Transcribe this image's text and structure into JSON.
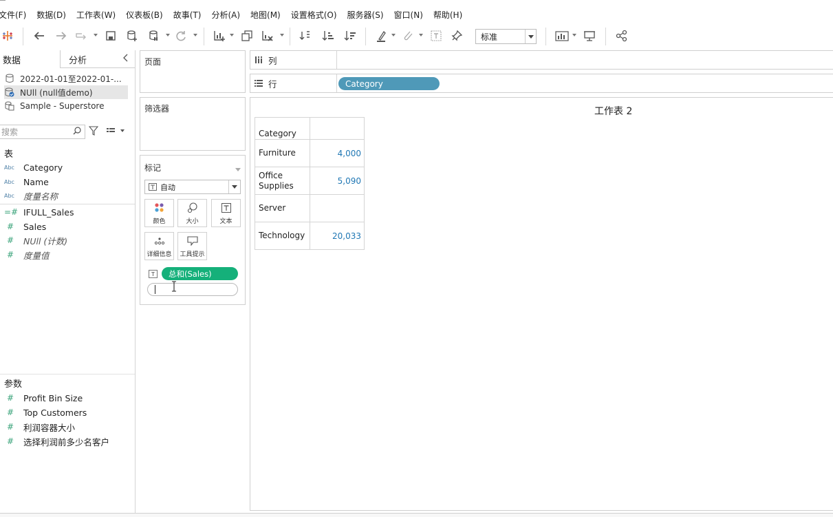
{
  "menu": [
    "文件(F)",
    "数据(D)",
    "工作表(W)",
    "仪表板(B)",
    "故事(T)",
    "分析(A)",
    "地图(M)",
    "设置格式(O)",
    "服务器(S)",
    "窗口(N)",
    "帮助(H)"
  ],
  "toolbar": {
    "fit_value": "标准",
    "icons": [
      "tableau-logo-icon",
      "undo-icon",
      "redo-icon",
      "replay-icon",
      "save-icon",
      "new-datasource-icon",
      "pause-update-icon",
      "refresh-icon",
      "new-sheet-icon",
      "duplicate-sheet-icon",
      "clear-sheet-icon",
      "swap-icon",
      "sort-ascending-icon",
      "sort-descending-icon",
      "highlight-icon",
      "group-icon",
      "label-icon",
      "pin-icon",
      "show-me-icon",
      "presentation-icon",
      "share-icon"
    ]
  },
  "left_pane": {
    "tab_data": "数据",
    "tab_analysis": "分析",
    "datasources": [
      {
        "label": "2022-01-01至2022-01-...",
        "icon": "database-icon",
        "selected": false
      },
      {
        "label": "NUll (null值demo)",
        "icon": "database-check-icon",
        "selected": true
      },
      {
        "label": "Sample - Superstore",
        "icon": "database-multi-icon",
        "selected": false
      }
    ],
    "search_placeholder": "搜索",
    "tables_header": "表",
    "dimensions": [
      {
        "type": "Abc",
        "name": "Category",
        "italic": false
      },
      {
        "type": "Abc",
        "name": "Name",
        "italic": false
      },
      {
        "type": "Abc",
        "name": "度量名称",
        "italic": true
      }
    ],
    "measures": [
      {
        "type": "=#",
        "name": "IFULL_Sales",
        "italic": false
      },
      {
        "type": "#",
        "name": "Sales",
        "italic": false
      },
      {
        "type": "#",
        "name": "NUll (计数)",
        "italic": true
      },
      {
        "type": "#",
        "name": "度量值",
        "italic": true
      }
    ],
    "params_header": "参数",
    "parameters": [
      {
        "type": "#",
        "name": "Profit Bin Size"
      },
      {
        "type": "#",
        "name": "Top Customers"
      },
      {
        "type": "#",
        "name": "利润容器大小"
      },
      {
        "type": "#",
        "name": "选择利润前多少名客户"
      }
    ]
  },
  "cards": {
    "pages": "页面",
    "filters": "筛选器",
    "marks": "标记",
    "mark_type": "自动",
    "mark_buttons": [
      "颜色",
      "大小",
      "文本",
      "详细信息",
      "工具提示"
    ],
    "text_pill": "总和(Sales)"
  },
  "shelves": {
    "columns_label": "列",
    "rows_label": "行",
    "row_pill": "Category"
  },
  "viz": {
    "title": "工作表 2",
    "header": "Category",
    "rows": [
      {
        "category": "Furniture",
        "value": "4,000"
      },
      {
        "category": "Office Supplies",
        "value": "5,090"
      },
      {
        "category": "Server",
        "value": ""
      },
      {
        "category": "Technology",
        "value": "20,033"
      }
    ]
  }
}
